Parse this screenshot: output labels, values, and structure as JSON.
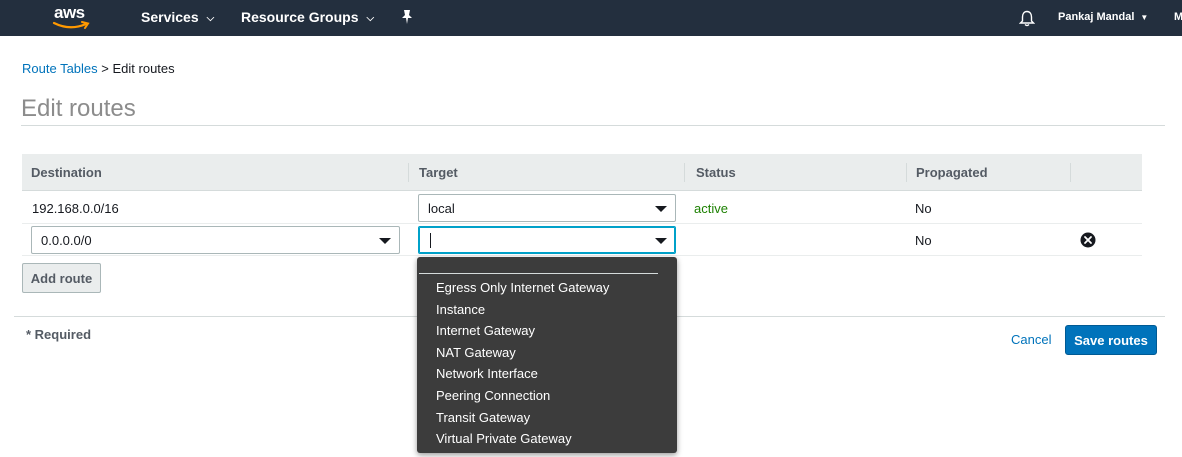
{
  "nav": {
    "logo": "aws",
    "services": "Services",
    "resource_groups": "Resource Groups",
    "user": "Pankaj Mandal",
    "region": "M"
  },
  "breadcrumb": {
    "link": "Route Tables",
    "separator": ">",
    "current": "Edit routes"
  },
  "page_title": "Edit routes",
  "table": {
    "headers": [
      "Destination",
      "Target",
      "Status",
      "Propagated"
    ],
    "rows": [
      {
        "destination": "192.168.0.0/16",
        "target": "local",
        "status": "active",
        "propagated": "No"
      },
      {
        "destination": "0.0.0.0/0",
        "target": "",
        "status": "",
        "propagated": "No"
      }
    ]
  },
  "add_route_label": "Add route",
  "required_label": "* Required",
  "cancel_label": "Cancel",
  "save_label": "Save routes",
  "target_options": [
    "Egress Only Internet Gateway",
    "Instance",
    "Internet Gateway",
    "NAT Gateway",
    "Network Interface",
    "Peering Connection",
    "Transit Gateway",
    "Virtual Private Gateway"
  ],
  "colors": {
    "nav_bg": "#232f3e",
    "link": "#0073bb",
    "status_active": "#1d8102",
    "primary_button": "#0073bb",
    "dropdown_bg": "#3c3c3c"
  }
}
